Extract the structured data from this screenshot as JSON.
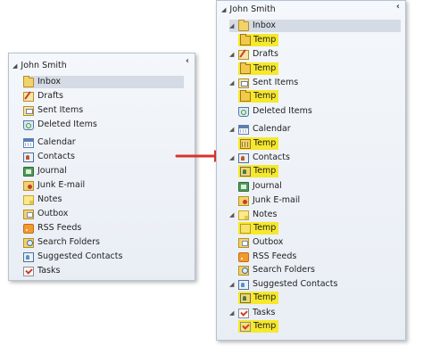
{
  "left_pane": {
    "account": "John Smith",
    "collapse_glyph": "‹",
    "items": [
      {
        "label": "Inbox",
        "icon": "inbox-folder-icon",
        "selected": true
      },
      {
        "label": "Drafts",
        "icon": "drafts-icon"
      },
      {
        "label": "Sent Items",
        "icon": "sent-items-icon"
      },
      {
        "label": "Deleted Items",
        "icon": "deleted-items-icon"
      },
      {
        "label": "Calendar",
        "icon": "calendar-icon"
      },
      {
        "label": "Contacts",
        "icon": "contacts-icon"
      },
      {
        "label": "Journal",
        "icon": "journal-icon"
      },
      {
        "label": "Junk E-mail",
        "icon": "junk-email-icon"
      },
      {
        "label": "Notes",
        "icon": "notes-icon"
      },
      {
        "label": "Outbox",
        "icon": "outbox-icon"
      },
      {
        "label": "RSS Feeds",
        "icon": "rss-feeds-icon"
      },
      {
        "label": "Search Folders",
        "icon": "search-folders-icon"
      },
      {
        "label": "Suggested Contacts",
        "icon": "suggested-contacts-icon"
      },
      {
        "label": "Tasks",
        "icon": "tasks-icon"
      }
    ]
  },
  "right_pane": {
    "account": "John Smith",
    "collapse_glyph": "‹",
    "items": [
      {
        "label": "Inbox",
        "icon": "inbox-folder-icon",
        "expanded": true,
        "selected": true
      },
      {
        "label": "Temp",
        "icon": "temp-folder-icon",
        "child": true,
        "highlight": true
      },
      {
        "label": "Drafts",
        "icon": "drafts-icon",
        "expanded": true
      },
      {
        "label": "Temp",
        "icon": "temp-folder-icon",
        "child": true,
        "highlight": true
      },
      {
        "label": "Sent Items",
        "icon": "sent-items-icon",
        "expanded": true
      },
      {
        "label": "Temp",
        "icon": "temp-folder-icon",
        "child": true,
        "highlight": true
      },
      {
        "label": "Deleted Items",
        "icon": "deleted-items-icon"
      },
      {
        "label": "Calendar",
        "icon": "calendar-icon",
        "expanded": true
      },
      {
        "label": "Temp",
        "icon": "temp-calendar-icon",
        "child": true,
        "highlight": true
      },
      {
        "label": "Contacts",
        "icon": "contacts-icon",
        "expanded": true
      },
      {
        "label": "Temp",
        "icon": "temp-contacts-icon",
        "child": true,
        "highlight": true
      },
      {
        "label": "Journal",
        "icon": "journal-icon"
      },
      {
        "label": "Junk E-mail",
        "icon": "junk-email-icon"
      },
      {
        "label": "Notes",
        "icon": "notes-icon",
        "expanded": true
      },
      {
        "label": "Temp",
        "icon": "temp-notes-icon",
        "child": true,
        "highlight": true
      },
      {
        "label": "Outbox",
        "icon": "outbox-icon"
      },
      {
        "label": "RSS Feeds",
        "icon": "rss-feeds-icon"
      },
      {
        "label": "Search Folders",
        "icon": "search-folders-icon"
      },
      {
        "label": "Suggested Contacts",
        "icon": "suggested-contacts-icon",
        "expanded": true
      },
      {
        "label": "Temp",
        "icon": "temp-contacts-icon",
        "child": true,
        "highlight": true
      },
      {
        "label": "Tasks",
        "icon": "tasks-icon",
        "expanded": true
      },
      {
        "label": "Temp",
        "icon": "temp-tasks-icon",
        "child": true,
        "highlight": true
      }
    ]
  },
  "colors": {
    "highlight": "#f5e82d",
    "arrow": "#d9332b",
    "selected_row": "#d4dbe5"
  }
}
